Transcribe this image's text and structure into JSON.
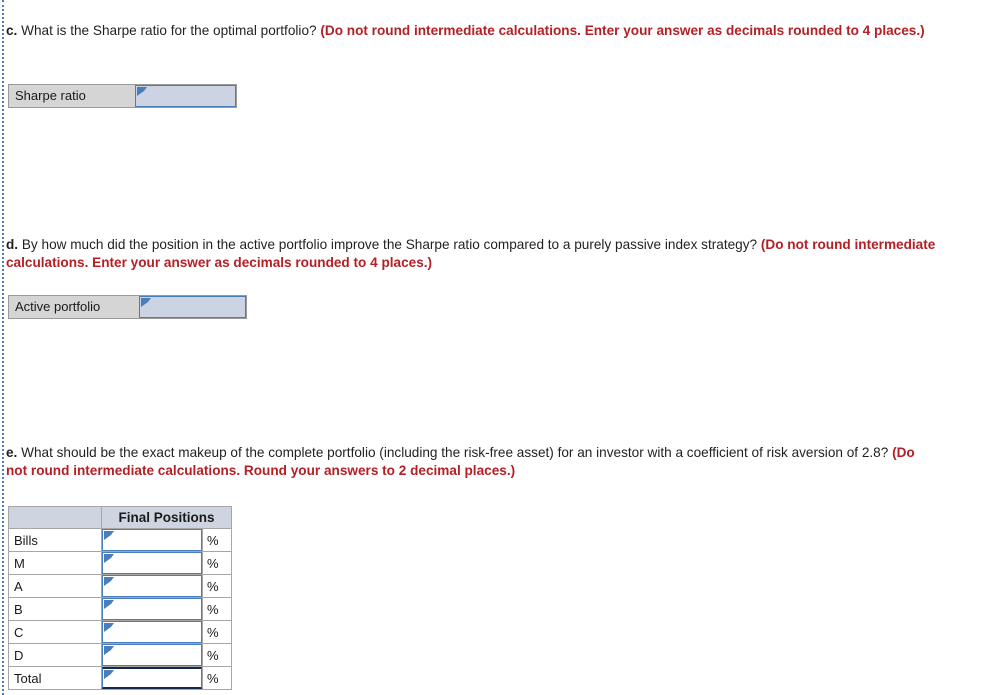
{
  "questions": {
    "c": {
      "letter": "c.",
      "text": " What is the Sharpe ratio for the optimal portfolio? ",
      "note": "(Do not round intermediate calculations. Enter your answer as decimals rounded to 4 places.)"
    },
    "d": {
      "letter": "d.",
      "text": " By how much did the position in the active portfolio improve the Sharpe ratio compared to a purely passive index strategy? ",
      "note": "(Do not round intermediate calculations. Enter your answer as decimals rounded to 4 places.)"
    },
    "e": {
      "letter": "e.",
      "text": " What should be the exact makeup of the complete portfolio (including the risk-free asset) for an investor with a coefficient of risk aversion of 2.8? ",
      "note": "(Do not round intermediate calculations. Round your answers to 2 decimal places.)"
    }
  },
  "answer_rows": {
    "sharpe": {
      "label": "Sharpe ratio",
      "value": ""
    },
    "active": {
      "label": "Active portfolio",
      "value": ""
    }
  },
  "positions_table": {
    "header": {
      "blank": "",
      "title": "Final Positions"
    },
    "unit": "%",
    "rows": [
      {
        "label": "Bills",
        "value": "",
        "unit": "%",
        "emphasis": false
      },
      {
        "label": "M",
        "value": "",
        "unit": "%",
        "emphasis": false
      },
      {
        "label": "A",
        "value": "",
        "unit": "%",
        "emphasis": false
      },
      {
        "label": "B",
        "value": "",
        "unit": "%",
        "emphasis": false
      },
      {
        "label": "C",
        "value": "",
        "unit": "%",
        "emphasis": false
      },
      {
        "label": "D",
        "value": "",
        "unit": "%",
        "emphasis": false
      },
      {
        "label": "Total",
        "value": "",
        "unit": "%",
        "emphasis": true
      }
    ]
  },
  "colors": {
    "note_red": "#b32025",
    "field_border_blue": "#4a7ebb",
    "field_fill_blue": "#ccd4e4",
    "label_fill_gray": "#d5d5d5",
    "header_fill": "#ced4e0",
    "emphasis_border": "#14274e"
  }
}
